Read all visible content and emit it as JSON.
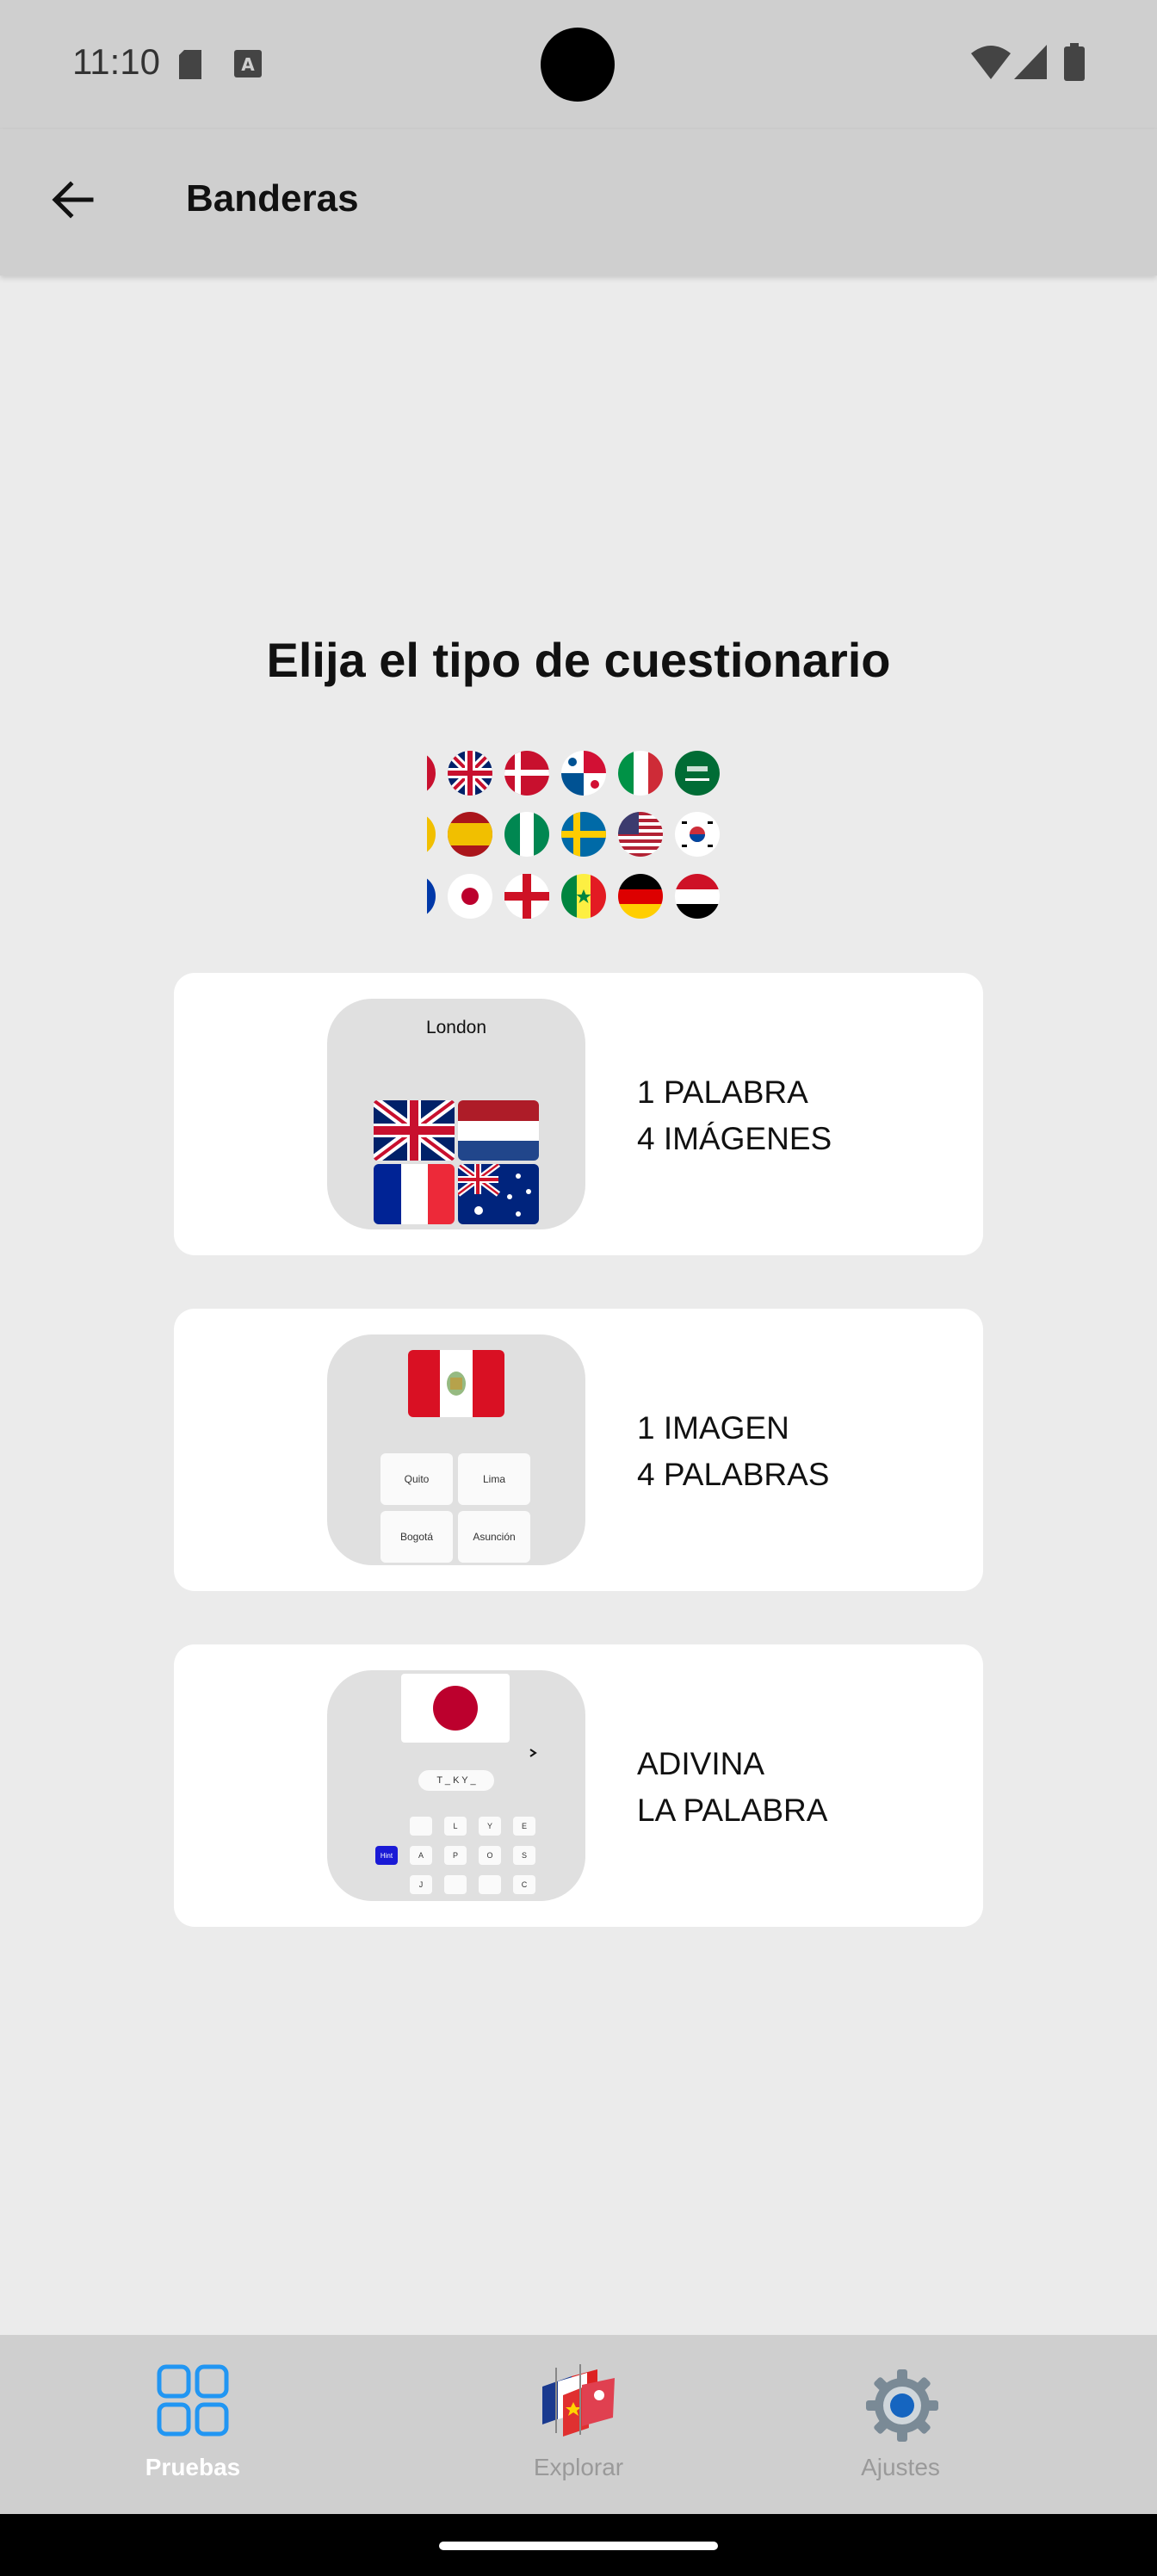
{
  "status": {
    "time": "11:10"
  },
  "header": {
    "title": "Banderas"
  },
  "main": {
    "heading": "Elija el tipo de cuestionario",
    "quiz_types": [
      {
        "line1": "1 PALABRA",
        "line2": "4 IMÁGENES",
        "preview_word": "London"
      },
      {
        "line1": "1 IMAGEN",
        "line2": "4 PALABRAS",
        "options": [
          "Quito",
          "Lima",
          "Bogotá",
          "Asunción"
        ]
      },
      {
        "line1": "ADIVINA",
        "line2": "LA PALABRA",
        "hint_pattern": "T _ K Y _",
        "hint_button": "Hint",
        "keys": [
          "",
          "L",
          "Y",
          "E",
          "A",
          "P",
          "O",
          "S",
          "J",
          "",
          "",
          "C"
        ]
      }
    ]
  },
  "bottom_nav": {
    "items": [
      {
        "label": "Pruebas",
        "icon": "grid-icon",
        "active": true
      },
      {
        "label": "Explorar",
        "icon": "flags-icon",
        "active": false
      },
      {
        "label": "Ajustes",
        "icon": "gear-icon",
        "active": false
      }
    ],
    "active_color": "#2196f3"
  }
}
